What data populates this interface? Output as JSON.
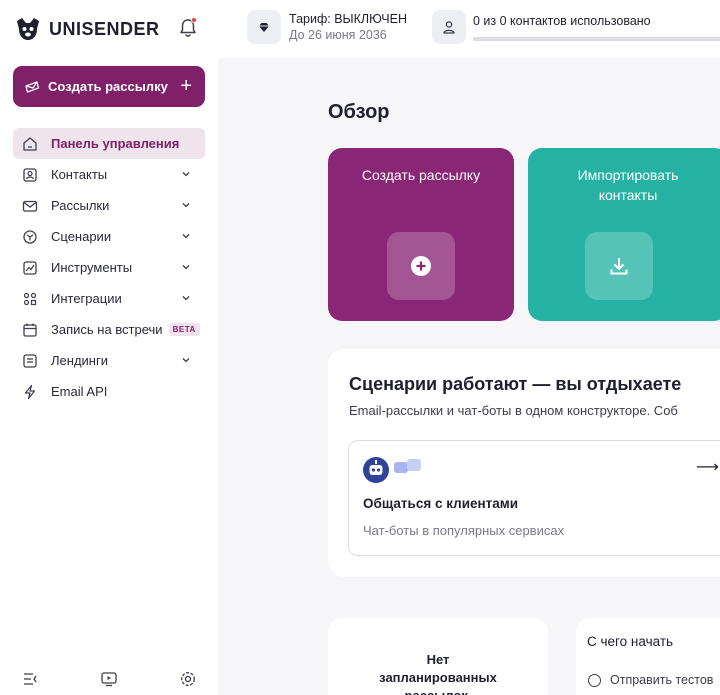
{
  "header": {
    "logo_text": "UNISENDER",
    "tariff_label": "Тариф: ВЫКЛЮЧЕН",
    "tariff_until": "До 26 июня 2036",
    "contacts_usage": "0 из 0 контактов использовано",
    "contacts_usage_fraction": 0
  },
  "sidebar": {
    "create_button": "Создать рассылку",
    "items": [
      {
        "label": "Панель управления",
        "icon": "home-icon",
        "active": true
      },
      {
        "label": "Контакты",
        "icon": "contacts-icon",
        "expandable": true
      },
      {
        "label": "Рассылки",
        "icon": "mail-icon",
        "expandable": true
      },
      {
        "label": "Сценарии",
        "icon": "scenarios-icon",
        "expandable": true
      },
      {
        "label": "Инструменты",
        "icon": "tools-icon",
        "expandable": true
      },
      {
        "label": "Интеграции",
        "icon": "integrations-icon",
        "expandable": true
      },
      {
        "label": "Запись на встречи",
        "icon": "calendar-icon",
        "badge": "BETA"
      },
      {
        "label": "Лендинги",
        "icon": "landing-icon",
        "expandable": true
      },
      {
        "label": "Email API",
        "icon": "lightning-icon"
      }
    ]
  },
  "main": {
    "title": "Обзор",
    "tiles": [
      {
        "label": "Создать рассылку",
        "icon": "plus-circle-icon",
        "color": "#8a2676"
      },
      {
        "label": "Импортировать контакты",
        "icon": "download-icon",
        "color": "#26b2a3"
      }
    ],
    "scenario_card": {
      "title": "Сценарии работают — вы отдыхаете",
      "subtitle": "Email-рассылки и чат-боты в одном конструкторе. Соб",
      "item_title": "Общаться с клиентами",
      "item_subtitle": "Чат-боты в популярных сервисах"
    },
    "scheduled_card": {
      "text": "Нет запланированных рассылок."
    },
    "start_card": {
      "title": "С чего начать",
      "item": "Отправить тестов"
    }
  },
  "colors": {
    "brand": "#7f2068",
    "teal": "#26b2a3",
    "tile_purple": "#8a2676"
  }
}
